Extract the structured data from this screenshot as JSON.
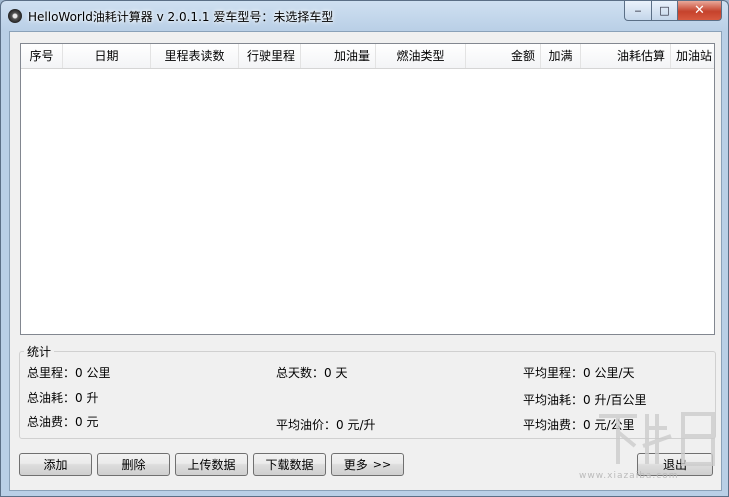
{
  "window": {
    "title": "HelloWorld油耗计算器 v 2.0.1.1  爱车型号：未选择车型",
    "controls": {
      "minimize": "‒",
      "maximize": "□",
      "close": "✕"
    }
  },
  "table": {
    "columns": [
      "序号",
      "日期",
      "里程表读数",
      "行驶里程",
      "加油量",
      "燃油类型",
      "金额",
      "加满",
      "油耗估算",
      "加油站"
    ],
    "rows": []
  },
  "stats": {
    "legend": "统计",
    "total_distance": {
      "label": "总里程",
      "value": "0 公里"
    },
    "total_days": {
      "label": "总天数",
      "value": "0 天"
    },
    "avg_distance": {
      "label": "平均里程",
      "value": "0 公里/天"
    },
    "total_fuel": {
      "label": "总油耗",
      "value": "0 升"
    },
    "avg_fuel": {
      "label": "平均油耗",
      "value": "0 升/百公里"
    },
    "total_cost": {
      "label": "总油费",
      "value": "0 元"
    },
    "avg_price": {
      "label": "平均油价",
      "value": "0 元/升"
    },
    "avg_cost": {
      "label": "平均油费",
      "value": "0 元/公里"
    }
  },
  "buttons": {
    "add": "添加",
    "delete": "删除",
    "upload": "上传数据",
    "download": "下载数据",
    "more": "更多",
    "more_icon": ">>",
    "exit": "退出"
  },
  "watermark": {
    "text": "www.xiazaiba.com"
  }
}
